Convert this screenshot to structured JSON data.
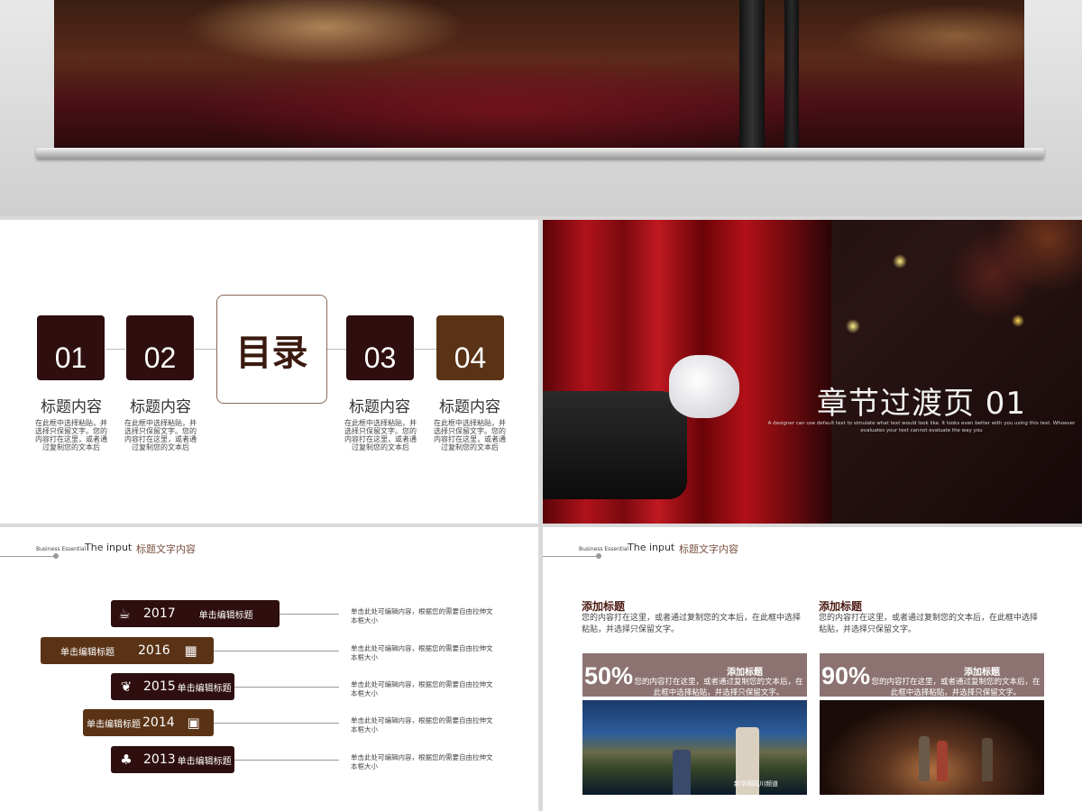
{
  "agenda": {
    "center": "目录",
    "items": [
      {
        "num": "01",
        "title": "标题内容",
        "desc": "在此框中选择粘贴，并选择只保留文字。您的内容打在这里，或者通过复制您的文本后"
      },
      {
        "num": "02",
        "title": "标题内容",
        "desc": "在此框中选择粘贴，并选择只保留文字。您的内容打在这里，或者通过复制您的文本后"
      },
      {
        "num": "03",
        "title": "标题内容",
        "desc": "在此框中选择粘贴，并选择只保留文字。您的内容打在这里，或者通过复制您的文本后"
      },
      {
        "num": "04",
        "title": "标题内容",
        "desc": "在此框中选择粘贴，并选择只保留文字。您的内容打在这里，或者通过复制您的文本后"
      }
    ]
  },
  "chapter": {
    "title": "章节过渡页 01",
    "subtitle": "A designer can use default text to simulate what text would look like. It looks even better with you using this text. Whoever evaluates your text cannot evaluate the way you"
  },
  "header": {
    "small": "Business Essential",
    "en": "The input",
    "cn": "标题文字内容"
  },
  "timeline": [
    {
      "year": "2017",
      "label": "单击编辑标题",
      "icon": "coffee-icon",
      "glyph": "☕",
      "desc": "单击此处可编辑内容，根据您的需要自由拉伸文本框大小"
    },
    {
      "year": "2016",
      "label": "单击编辑标题",
      "icon": "calendar-icon",
      "glyph": "▦",
      "desc": "单击此处可编辑内容，根据您的需要自由拉伸文本框大小"
    },
    {
      "year": "2015",
      "label": "单击编辑标题",
      "icon": "leaf-icon",
      "glyph": "❦",
      "desc": "单击此处可编辑内容，根据您的需要自由拉伸文本框大小"
    },
    {
      "year": "2014",
      "label": "单击编辑标题",
      "icon": "briefcase-icon",
      "glyph": "▣",
      "desc": "单击此处可编辑内容，根据您的需要自由拉伸文本框大小"
    },
    {
      "year": "2013",
      "label": "单击编辑标题",
      "icon": "apple-books-icon",
      "glyph": "♣",
      "desc": "单击此处可编辑内容，根据您的需要自由拉伸文本框大小"
    }
  ],
  "stats": {
    "blocks": [
      {
        "title": "添加标题",
        "text": "您的内容打在这里，或者通过复制您的文本后，在此框中选择粘贴，并选择只保留文字。"
      },
      {
        "title": "添加标题",
        "text": "您的内容打在这里，或者通过复制您的文本后，在此框中选择粘贴，并选择只保留文字。"
      }
    ],
    "bars": [
      {
        "pct": "50%",
        "title": "添加标题",
        "text": "您的内容打在这里，或者通过复制您的文本后，在此框中选择粘贴，并选择只保留文字。"
      },
      {
        "pct": "90%",
        "title": "添加标题",
        "text": "您的内容打在这里，或者通过复制您的文本后，在此框中选择粘贴，并选择只保留文字。"
      }
    ],
    "watermark": "新华网四川频道"
  }
}
